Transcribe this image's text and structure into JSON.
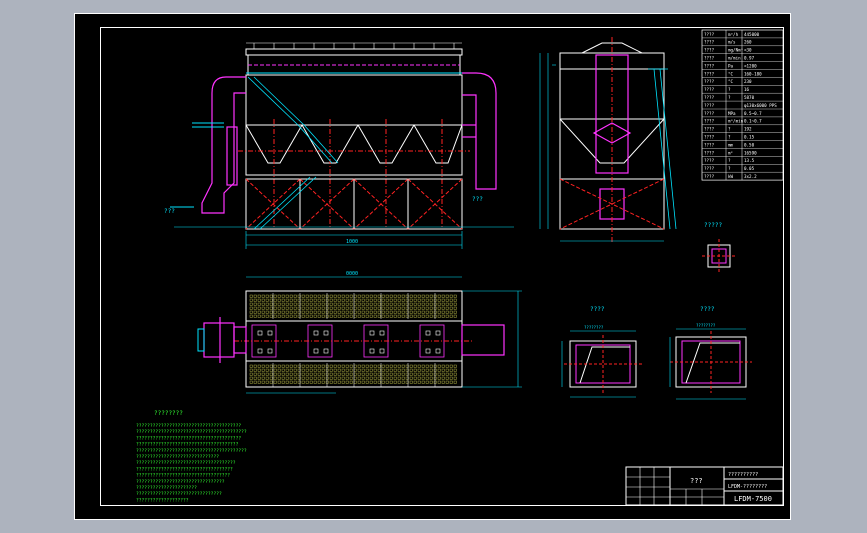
{
  "colors": {
    "background": "#000000",
    "frame": "#ffffff",
    "steel": "#ffffff",
    "ducts": "#ff33ff",
    "centerlines": "#ff2222",
    "dimensions": "#00e5ff",
    "ladders": "#00e5ff",
    "notes": "#33ff33",
    "filter_rows": "#ffff55",
    "viewport_border": "#adb3be"
  },
  "labels": {
    "inlet_arrow": "???",
    "outlet_arrow": "???",
    "flange_detail": "?????",
    "section_a": "????",
    "section_b": "????",
    "notes_title": "????????",
    "title_block_name": "???",
    "title_block_drawing": "??????????",
    "title_block_model": "LFDM-????????",
    "title_block_code": "LFDM-7500",
    "dim_overall_length": "1000",
    "dim_total_width": "0000",
    "dim_section_a": "????????",
    "dim_section_b": "????????"
  },
  "spec_table": [
    {
      "name": "????",
      "unit": "m³/h",
      "value": "445000"
    },
    {
      "name": "????",
      "unit": "m/s",
      "value": "260"
    },
    {
      "name": "????",
      "unit": "mg/Nm³",
      "value": "<30"
    },
    {
      "name": "????",
      "unit": "m/min",
      "value": "0.97"
    },
    {
      "name": "????",
      "unit": "Pa",
      "value": "<1200"
    },
    {
      "name": "????",
      "unit": "°C",
      "value": "160-180"
    },
    {
      "name": "????",
      "unit": "°C",
      "value": "230"
    },
    {
      "name": "????",
      "unit": "?",
      "value": "16"
    },
    {
      "name": "????",
      "unit": "?",
      "value": "5870"
    },
    {
      "name": "????",
      "unit": "",
      "value": "φ130x6000 PPS"
    },
    {
      "name": "????",
      "unit": "MPa",
      "value": "0.5~0.7"
    },
    {
      "name": "????",
      "unit": "m³/min",
      "value": "0.1~0.7"
    },
    {
      "name": "????",
      "unit": "?",
      "value": "192"
    },
    {
      "name": "????",
      "unit": "?",
      "value": "0.15"
    },
    {
      "name": "????",
      "unit": "mm",
      "value": "0.50"
    },
    {
      "name": "????",
      "unit": "m²",
      "value": "16590"
    },
    {
      "name": "????",
      "unit": "?",
      "value": "13.5"
    },
    {
      "name": "????",
      "unit": "?",
      "value": "0.05"
    },
    {
      "name": "????",
      "unit": "kW",
      "value": "3x2.2"
    }
  ],
  "notes": [
    "??????????????????????????????????????",
    "????????????????????????????????????????",
    "??????????????????????????????????????",
    "?????????????????????????????????????",
    "????????????????????????????????????????",
    "??????????????????????????????",
    "????????????????????????????????????",
    "???????????????????????????????????",
    "??????????????????????????????????",
    "????????????????????????????????",
    "??????????????????????",
    "???????????????????????????????",
    "???????????????????"
  ]
}
